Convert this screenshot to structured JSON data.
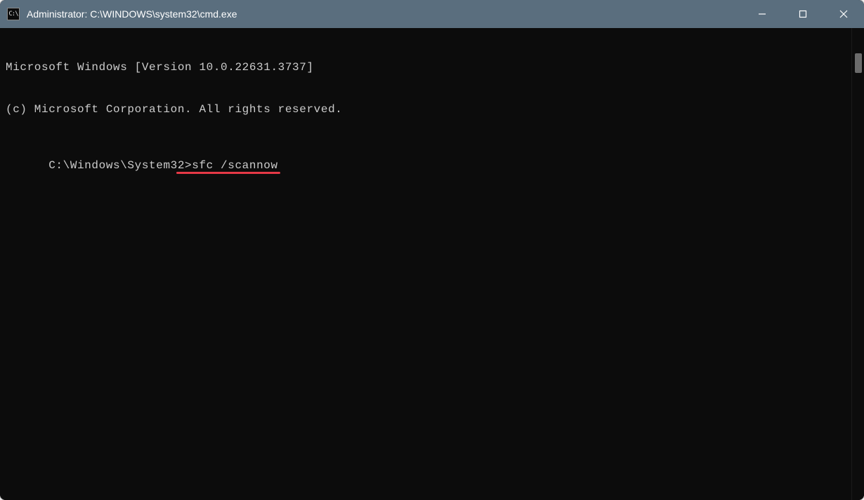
{
  "titlebar": {
    "icon_label": "C:\\",
    "title": "Administrator: C:\\WINDOWS\\system32\\cmd.exe"
  },
  "terminal": {
    "line1": "Microsoft Windows [Version 10.0.22631.3737]",
    "line2": "(c) Microsoft Corporation. All rights reserved.",
    "blank": "",
    "prompt": "C:\\Windows\\System32>",
    "command": "sfc /scannow"
  },
  "annotation": {
    "underline_color": "#e63946"
  }
}
